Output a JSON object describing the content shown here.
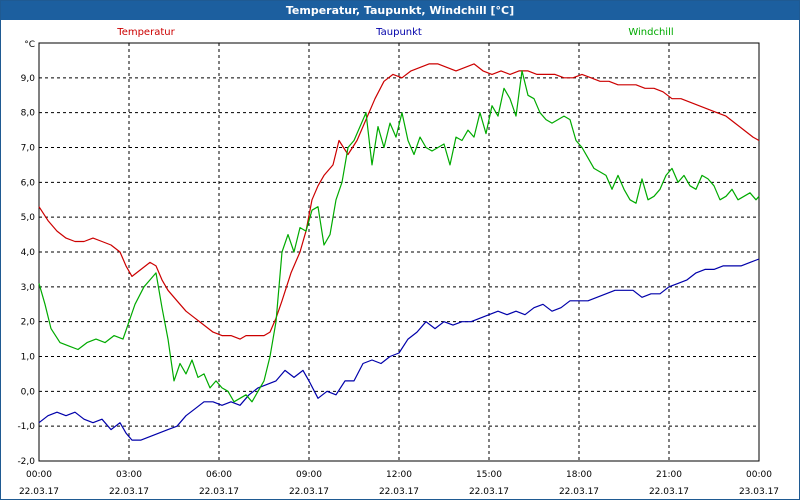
{
  "window": {
    "title": "Temperatur, Taupunkt, Windchill [°C]"
  },
  "chart_data": {
    "type": "line",
    "unit_label": "°C",
    "ylim": [
      -2.0,
      10.0
    ],
    "y_ticks": [
      "9,0",
      "8,0",
      "7,0",
      "6,0",
      "5,0",
      "4,0",
      "3,0",
      "2,0",
      "1,0",
      "0,0",
      "-1,0",
      "-2,0"
    ],
    "y_tick_values": [
      9,
      8,
      7,
      6,
      5,
      4,
      3,
      2,
      1,
      0,
      -1,
      -2
    ],
    "xlim": [
      0,
      24
    ],
    "x_tick_values": [
      0,
      3,
      6,
      9,
      12,
      15,
      18,
      21,
      24
    ],
    "x_ticks": [
      {
        "time": "00:00",
        "date": "22.03.17"
      },
      {
        "time": "03:00",
        "date": "22.03.17"
      },
      {
        "time": "06:00",
        "date": "22.03.17"
      },
      {
        "time": "09:00",
        "date": "22.03.17"
      },
      {
        "time": "12:00",
        "date": "22.03.17"
      },
      {
        "time": "15:00",
        "date": "22.03.17"
      },
      {
        "time": "18:00",
        "date": "22.03.17"
      },
      {
        "time": "21:00",
        "date": "22.03.17"
      },
      {
        "time": "00:00",
        "date": "23.03.17"
      }
    ],
    "grid": true,
    "legend_position": "top",
    "series": [
      {
        "name": "Temperatur",
        "color": "#cc0000",
        "x": [
          0,
          0.3,
          0.6,
          0.9,
          1.2,
          1.5,
          1.8,
          2.1,
          2.4,
          2.7,
          2.9,
          3.1,
          3.4,
          3.7,
          3.9,
          4.1,
          4.3,
          4.6,
          4.9,
          5.2,
          5.5,
          5.8,
          6.1,
          6.4,
          6.7,
          6.9,
          7.2,
          7.5,
          7.7,
          7.9,
          8.1,
          8.4,
          8.7,
          8.9,
          9.1,
          9.3,
          9.5,
          9.8,
          10.0,
          10.3,
          10.6,
          10.9,
          11.2,
          11.5,
          11.8,
          12.1,
          12.4,
          12.7,
          13.0,
          13.3,
          13.6,
          13.9,
          14.2,
          14.5,
          14.8,
          15.1,
          15.4,
          15.7,
          16.0,
          16.3,
          16.6,
          16.9,
          17.2,
          17.5,
          17.8,
          18.1,
          18.4,
          18.7,
          19.0,
          19.3,
          19.6,
          19.9,
          20.2,
          20.5,
          20.8,
          21.1,
          21.4,
          21.7,
          22.0,
          22.3,
          22.6,
          22.9,
          23.2,
          23.5,
          23.8,
          24.0
        ],
        "y": [
          5.3,
          4.9,
          4.6,
          4.4,
          4.3,
          4.3,
          4.4,
          4.3,
          4.2,
          4.0,
          3.6,
          3.3,
          3.5,
          3.7,
          3.6,
          3.2,
          2.9,
          2.6,
          2.3,
          2.1,
          1.9,
          1.7,
          1.6,
          1.6,
          1.5,
          1.6,
          1.6,
          1.6,
          1.7,
          2.1,
          2.6,
          3.4,
          4.0,
          4.6,
          5.5,
          5.9,
          6.2,
          6.5,
          7.2,
          6.8,
          7.2,
          7.8,
          8.4,
          8.9,
          9.1,
          9.0,
          9.2,
          9.3,
          9.4,
          9.4,
          9.3,
          9.2,
          9.3,
          9.4,
          9.2,
          9.1,
          9.2,
          9.1,
          9.2,
          9.2,
          9.1,
          9.1,
          9.1,
          9.0,
          9.0,
          9.1,
          9.0,
          8.9,
          8.9,
          8.8,
          8.8,
          8.8,
          8.7,
          8.7,
          8.6,
          8.4,
          8.4,
          8.3,
          8.2,
          8.1,
          8.0,
          7.9,
          7.7,
          7.5,
          7.3,
          7.2
        ]
      },
      {
        "name": "Taupunkt",
        "color": "#0000aa",
        "x": [
          0,
          0.3,
          0.6,
          0.9,
          1.2,
          1.5,
          1.8,
          2.1,
          2.4,
          2.7,
          2.9,
          3.1,
          3.4,
          3.7,
          4.0,
          4.3,
          4.6,
          4.9,
          5.2,
          5.5,
          5.8,
          6.1,
          6.4,
          6.7,
          7.0,
          7.3,
          7.6,
          7.9,
          8.2,
          8.5,
          8.8,
          9.0,
          9.3,
          9.6,
          9.9,
          10.2,
          10.5,
          10.8,
          11.1,
          11.4,
          11.7,
          12.0,
          12.3,
          12.6,
          12.9,
          13.2,
          13.5,
          13.8,
          14.1,
          14.4,
          14.7,
          15.0,
          15.3,
          15.6,
          15.9,
          16.2,
          16.5,
          16.8,
          17.1,
          17.4,
          17.7,
          18.0,
          18.3,
          18.6,
          18.9,
          19.2,
          19.5,
          19.8,
          20.1,
          20.4,
          20.7,
          21.0,
          21.3,
          21.6,
          21.9,
          22.2,
          22.5,
          22.8,
          23.1,
          23.4,
          23.7,
          24.0
        ],
        "y": [
          -0.9,
          -0.7,
          -0.6,
          -0.7,
          -0.6,
          -0.8,
          -0.9,
          -0.8,
          -1.1,
          -0.9,
          -1.2,
          -1.4,
          -1.4,
          -1.3,
          -1.2,
          -1.1,
          -1.0,
          -0.7,
          -0.5,
          -0.3,
          -0.3,
          -0.4,
          -0.3,
          -0.4,
          -0.1,
          0.1,
          0.2,
          0.3,
          0.6,
          0.4,
          0.6,
          0.3,
          -0.2,
          0.0,
          -0.1,
          0.3,
          0.3,
          0.8,
          0.9,
          0.8,
          1.0,
          1.1,
          1.5,
          1.7,
          2.0,
          1.8,
          2.0,
          1.9,
          2.0,
          2.0,
          2.1,
          2.2,
          2.3,
          2.2,
          2.3,
          2.2,
          2.4,
          2.5,
          2.3,
          2.4,
          2.6,
          2.6,
          2.6,
          2.7,
          2.8,
          2.9,
          2.9,
          2.9,
          2.7,
          2.8,
          2.8,
          3.0,
          3.1,
          3.2,
          3.4,
          3.5,
          3.5,
          3.6,
          3.6,
          3.6,
          3.7,
          3.8
        ]
      },
      {
        "name": "Windchill",
        "color": "#00aa00",
        "x": [
          0,
          0.2,
          0.4,
          0.7,
          1.0,
          1.3,
          1.6,
          1.9,
          2.2,
          2.5,
          2.8,
          3.0,
          3.2,
          3.5,
          3.7,
          3.9,
          4.1,
          4.3,
          4.5,
          4.7,
          4.9,
          5.1,
          5.3,
          5.5,
          5.7,
          5.9,
          6.1,
          6.3,
          6.5,
          6.7,
          6.9,
          7.1,
          7.3,
          7.5,
          7.7,
          7.9,
          8.1,
          8.3,
          8.5,
          8.7,
          8.9,
          9.1,
          9.3,
          9.5,
          9.7,
          9.9,
          10.1,
          10.3,
          10.5,
          10.7,
          10.9,
          11.1,
          11.3,
          11.5,
          11.7,
          11.9,
          12.1,
          12.3,
          12.5,
          12.7,
          12.9,
          13.1,
          13.3,
          13.5,
          13.7,
          13.9,
          14.1,
          14.3,
          14.5,
          14.7,
          14.9,
          15.1,
          15.3,
          15.5,
          15.7,
          15.9,
          16.1,
          16.3,
          16.5,
          16.7,
          16.9,
          17.1,
          17.3,
          17.5,
          17.7,
          17.9,
          18.1,
          18.3,
          18.5,
          18.7,
          18.9,
          19.1,
          19.3,
          19.5,
          19.7,
          19.9,
          20.1,
          20.3,
          20.5,
          20.7,
          20.9,
          21.1,
          21.3,
          21.5,
          21.7,
          21.9,
          22.1,
          22.3,
          22.5,
          22.7,
          22.9,
          23.1,
          23.3,
          23.5,
          23.7,
          23.9,
          24.0
        ],
        "y": [
          3.1,
          2.5,
          1.8,
          1.4,
          1.3,
          1.2,
          1.4,
          1.5,
          1.4,
          1.6,
          1.5,
          2.0,
          2.5,
          3.0,
          3.2,
          3.4,
          2.4,
          1.5,
          0.3,
          0.8,
          0.5,
          0.9,
          0.4,
          0.5,
          0.1,
          0.3,
          0.1,
          0.0,
          -0.3,
          -0.2,
          -0.1,
          -0.3,
          0.0,
          0.3,
          1.0,
          2.0,
          4.0,
          4.5,
          4.0,
          4.7,
          4.6,
          5.2,
          5.3,
          4.2,
          4.5,
          5.5,
          6.0,
          7.0,
          7.2,
          7.6,
          8.0,
          6.5,
          7.6,
          7.0,
          7.7,
          7.3,
          8.0,
          7.2,
          6.8,
          7.3,
          7.0,
          6.9,
          7.0,
          7.1,
          6.5,
          7.3,
          7.2,
          7.5,
          7.3,
          8.0,
          7.4,
          8.2,
          7.9,
          8.7,
          8.4,
          7.9,
          9.2,
          8.5,
          8.4,
          8.0,
          7.8,
          7.7,
          7.8,
          7.9,
          7.8,
          7.2,
          7.0,
          6.7,
          6.4,
          6.3,
          6.2,
          5.8,
          6.2,
          5.8,
          5.5,
          5.4,
          6.1,
          5.5,
          5.6,
          5.8,
          6.2,
          6.4,
          6.0,
          6.2,
          5.9,
          5.8,
          6.2,
          6.1,
          5.9,
          5.5,
          5.6,
          5.8,
          5.5,
          5.6,
          5.7,
          5.5,
          5.6
        ]
      }
    ]
  }
}
